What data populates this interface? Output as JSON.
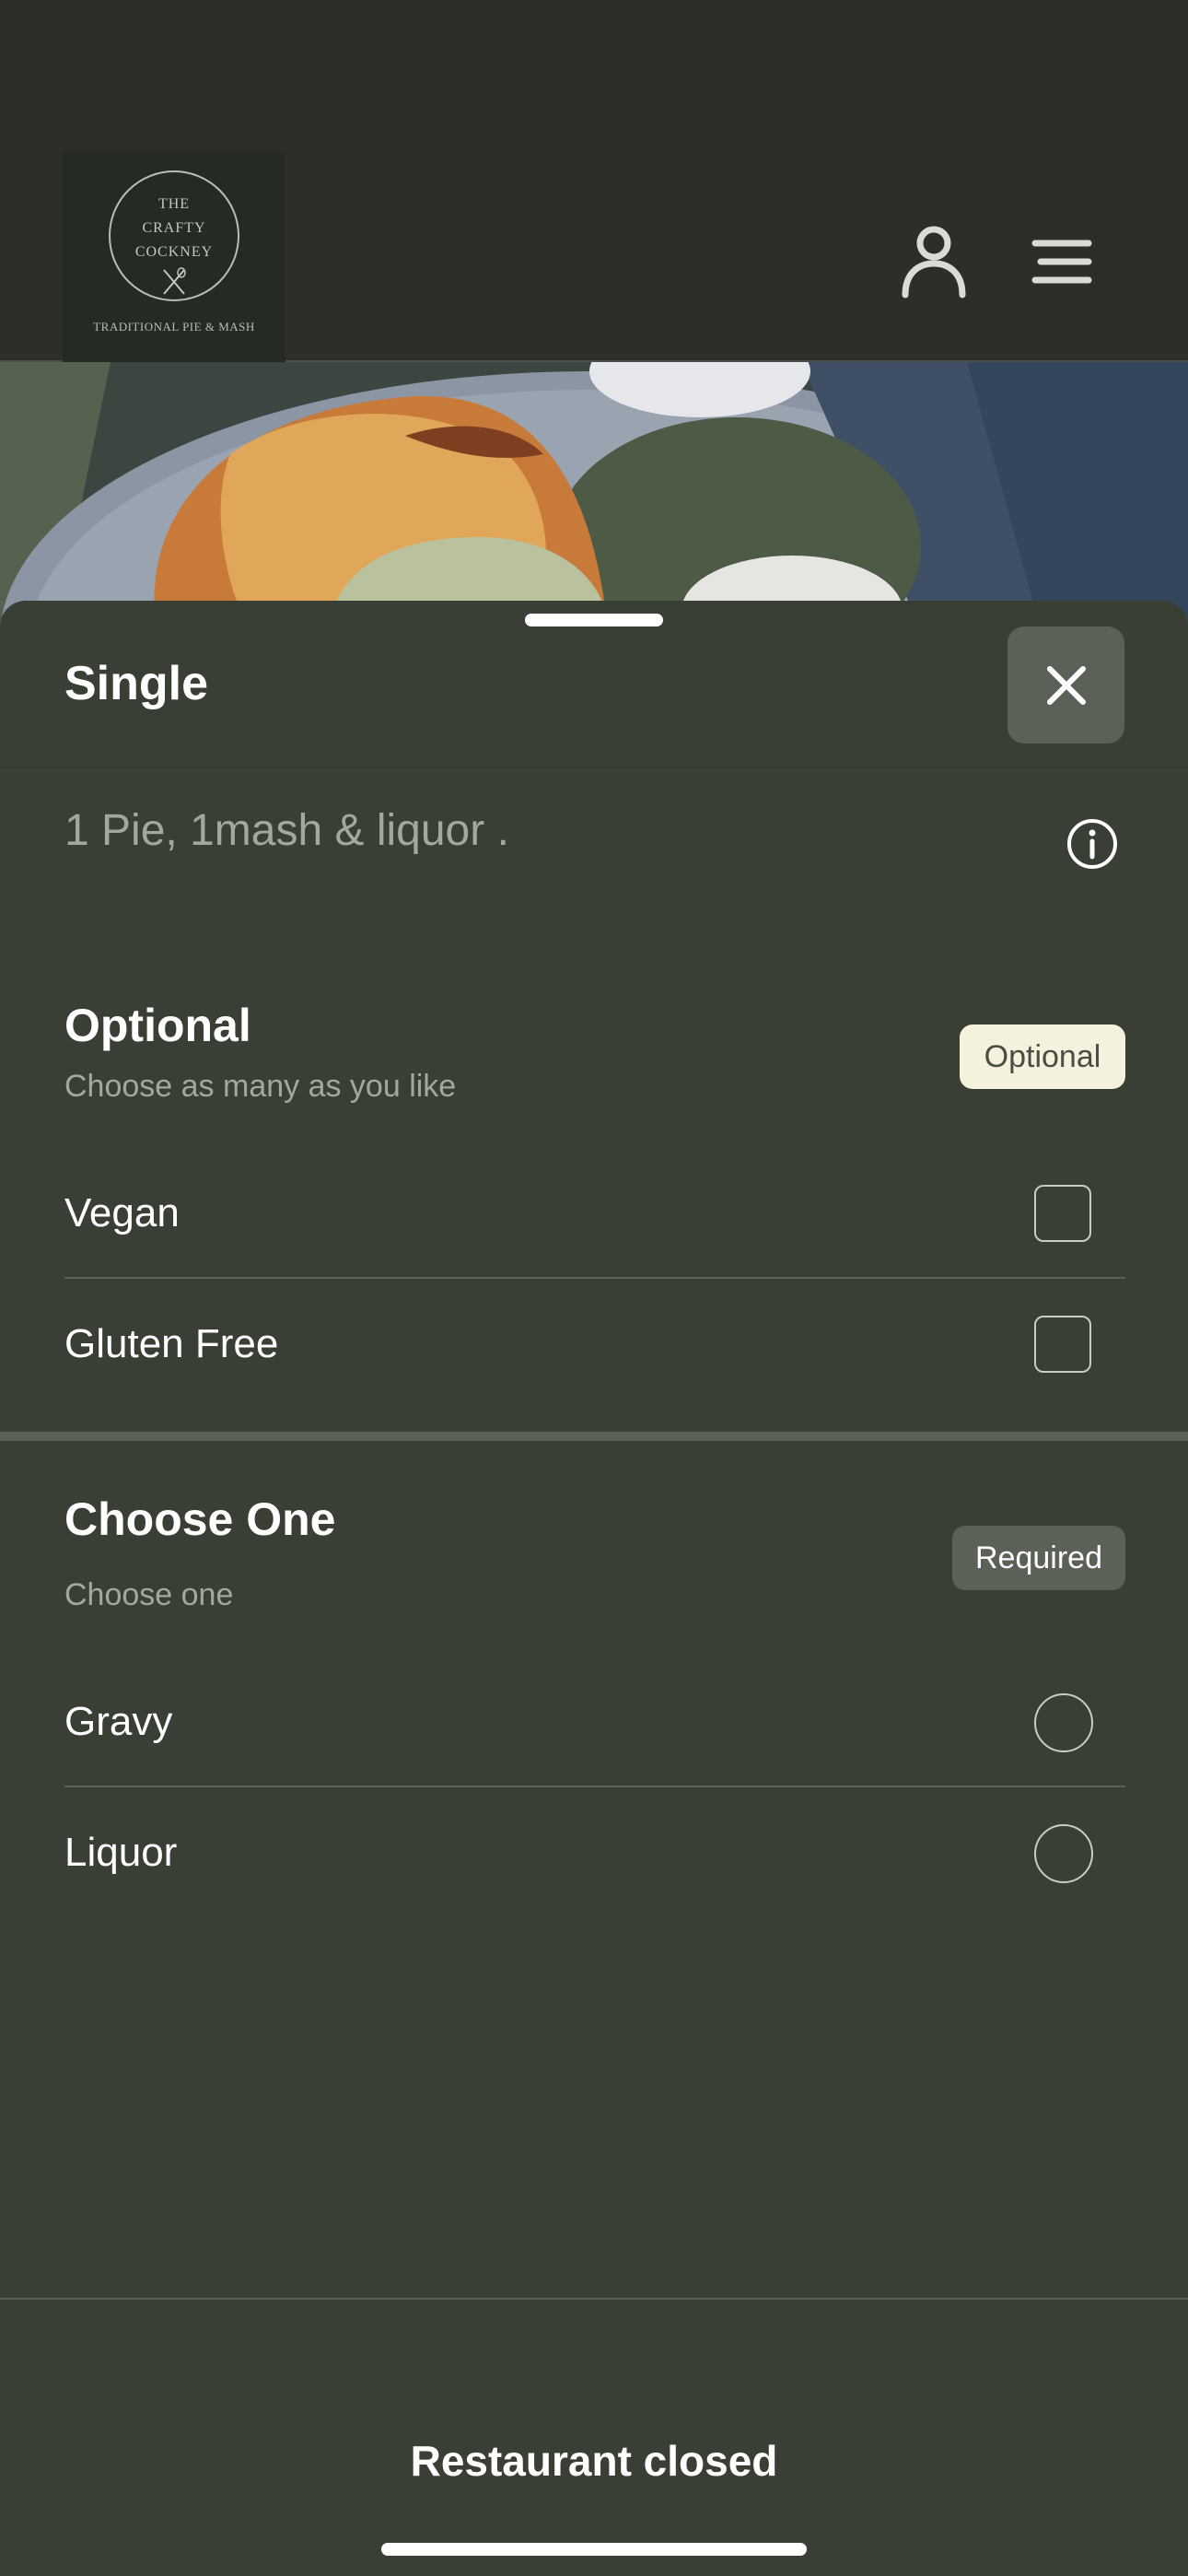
{
  "header": {
    "logo": {
      "lines": [
        "THE",
        "CRAFTY",
        "COCKNEY"
      ],
      "tagline": "TRADITIONAL PIE & MASH"
    },
    "icons": [
      "user-icon",
      "menu-icon"
    ]
  },
  "sheet": {
    "title": "Single",
    "description": "1 Pie, 1mash & liquor .",
    "close_icon": "close-icon",
    "info_icon": "info-icon"
  },
  "optional_group": {
    "title": "Optional",
    "subtitle": "Choose as many as you like",
    "badge": "Optional",
    "options": [
      {
        "label": "Vegan",
        "checked": false
      },
      {
        "label": "Gluten Free",
        "checked": false
      }
    ]
  },
  "choose_group": {
    "title": "Choose One",
    "subtitle": "Choose one",
    "badge": "Required",
    "options": [
      {
        "label": "Gravy",
        "selected": false
      },
      {
        "label": "Liquor",
        "selected": false
      }
    ]
  },
  "footer": {
    "status": "Restaurant closed"
  },
  "colors": {
    "background": "#2b2f28",
    "sheet": "#393f35",
    "badge_optional": "#f4f1dc",
    "badge_required": "#5b6157"
  }
}
